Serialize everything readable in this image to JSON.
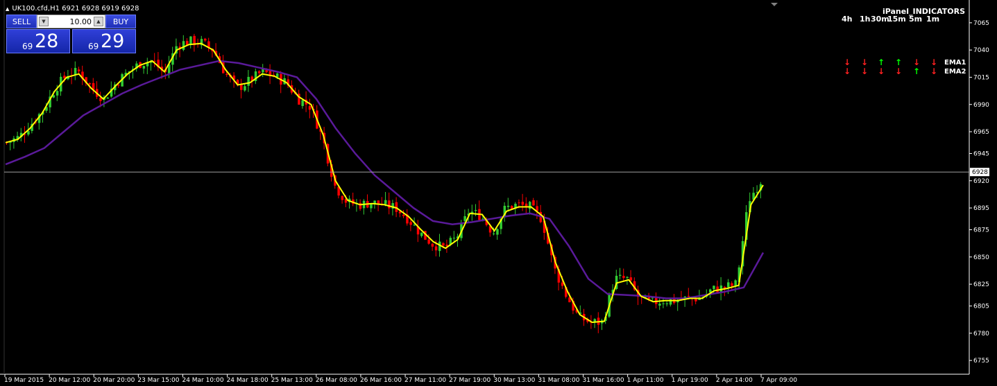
{
  "window": {
    "symbol_line": "UK100.cfd,H1  6921 6928 6919 6928"
  },
  "trade_panel": {
    "sell_label": "SELL",
    "buy_label": "BUY",
    "lot_value": "10.00",
    "bid_prefix": "69",
    "bid_big": "28",
    "ask_prefix": "69",
    "ask_big": "29"
  },
  "ipanel": {
    "title": "iPanel_INDICATORS",
    "timeframes": [
      "4h",
      "1h",
      "30m",
      "15m",
      "5m",
      "1m"
    ],
    "rows": [
      {
        "label": "EMA1",
        "signals": [
          "down",
          "down",
          "up",
          "up",
          "down",
          "down"
        ]
      },
      {
        "label": "EMA2",
        "signals": [
          "down",
          "down",
          "down",
          "down",
          "up",
          "down"
        ]
      }
    ]
  },
  "colors": {
    "background": "#000000",
    "bull_candle": "#32cd32",
    "bear_candle": "#ff0000",
    "ema_fast": "#ffff00",
    "ema_slow": "#5a1a9a",
    "up_arrow": "#00ff00",
    "down_arrow": "#ff2020",
    "grid_text": "#ffffff"
  },
  "chart_data": {
    "type": "candlestick",
    "symbol": "UK100.cfd",
    "timeframe": "H1",
    "ylim": [
      6750,
      7070
    ],
    "y_ticks": [
      7065,
      7040,
      7015,
      6990,
      6965,
      6945,
      6920,
      6895,
      6875,
      6850,
      6825,
      6805,
      6780,
      6755
    ],
    "current_price": 6928,
    "current_price_label": "6928",
    "x_tick_labels": [
      "19 Mar 2015",
      "20 Mar 12:00",
      "20 Mar 20:00",
      "23 Mar 15:00",
      "24 Mar 10:00",
      "24 Mar 18:00",
      "25 Mar 13:00",
      "26 Mar 08:00",
      "26 Mar 16:00",
      "27 Mar 11:00",
      "27 Mar 19:00",
      "30 Mar 13:00",
      "31 Mar 08:00",
      "31 Mar 16:00",
      "1 Apr 11:00",
      "1 Apr 19:00",
      "2 Apr 14:00",
      "7 Apr 09:00"
    ],
    "close_path": [
      6955,
      6960,
      6972,
      6985,
      7005,
      7018,
      7020,
      7005,
      6995,
      7010,
      7020,
      7028,
      7030,
      7018,
      7045,
      7048,
      7047,
      7040,
      7018,
      7005,
      7012,
      7020,
      7016,
      7010,
      6995,
      6988,
      6958,
      6915,
      6900,
      6898,
      6900,
      6898,
      6895,
      6885,
      6872,
      6862,
      6858,
      6868,
      6892,
      6888,
      6872,
      6895,
      6898,
      6896,
      6885,
      6840,
      6815,
      6795,
      6790,
      6790,
      6830,
      6830,
      6812,
      6808,
      6810,
      6810,
      6812,
      6812,
      6820,
      6822,
      6825,
      6902,
      6920
    ],
    "ema1_path": [
      6955,
      6958,
      6968,
      6982,
      7002,
      7015,
      7018,
      7005,
      6995,
      7007,
      7018,
      7026,
      7030,
      7020,
      7040,
      7045,
      7046,
      7040,
      7022,
      7008,
      7010,
      7018,
      7016,
      7010,
      6997,
      6990,
      6962,
      6920,
      6902,
      6898,
      6899,
      6898,
      6895,
      6887,
      6875,
      6864,
      6858,
      6866,
      6890,
      6889,
      6874,
      6892,
      6896,
      6896,
      6887,
      6845,
      6818,
      6797,
      6790,
      6791,
      6826,
      6829,
      6814,
      6809,
      6810,
      6810,
      6812,
      6812,
      6819,
      6821,
      6824,
      6898,
      6916
    ],
    "ema2_path": [
      6935,
      6942,
      6950,
      6965,
      6980,
      6990,
      7000,
      7008,
      7015,
      7022,
      7026,
      7030,
      7028,
      7024,
      7020,
      7015,
      6995,
      6968,
      6945,
      6925,
      6910,
      6895,
      6883,
      6880,
      6882,
      6885,
      6888,
      6890,
      6885,
      6860,
      6830,
      6816,
      6815,
      6814,
      6812,
      6812,
      6815,
      6818,
      6822,
      6854
    ]
  }
}
